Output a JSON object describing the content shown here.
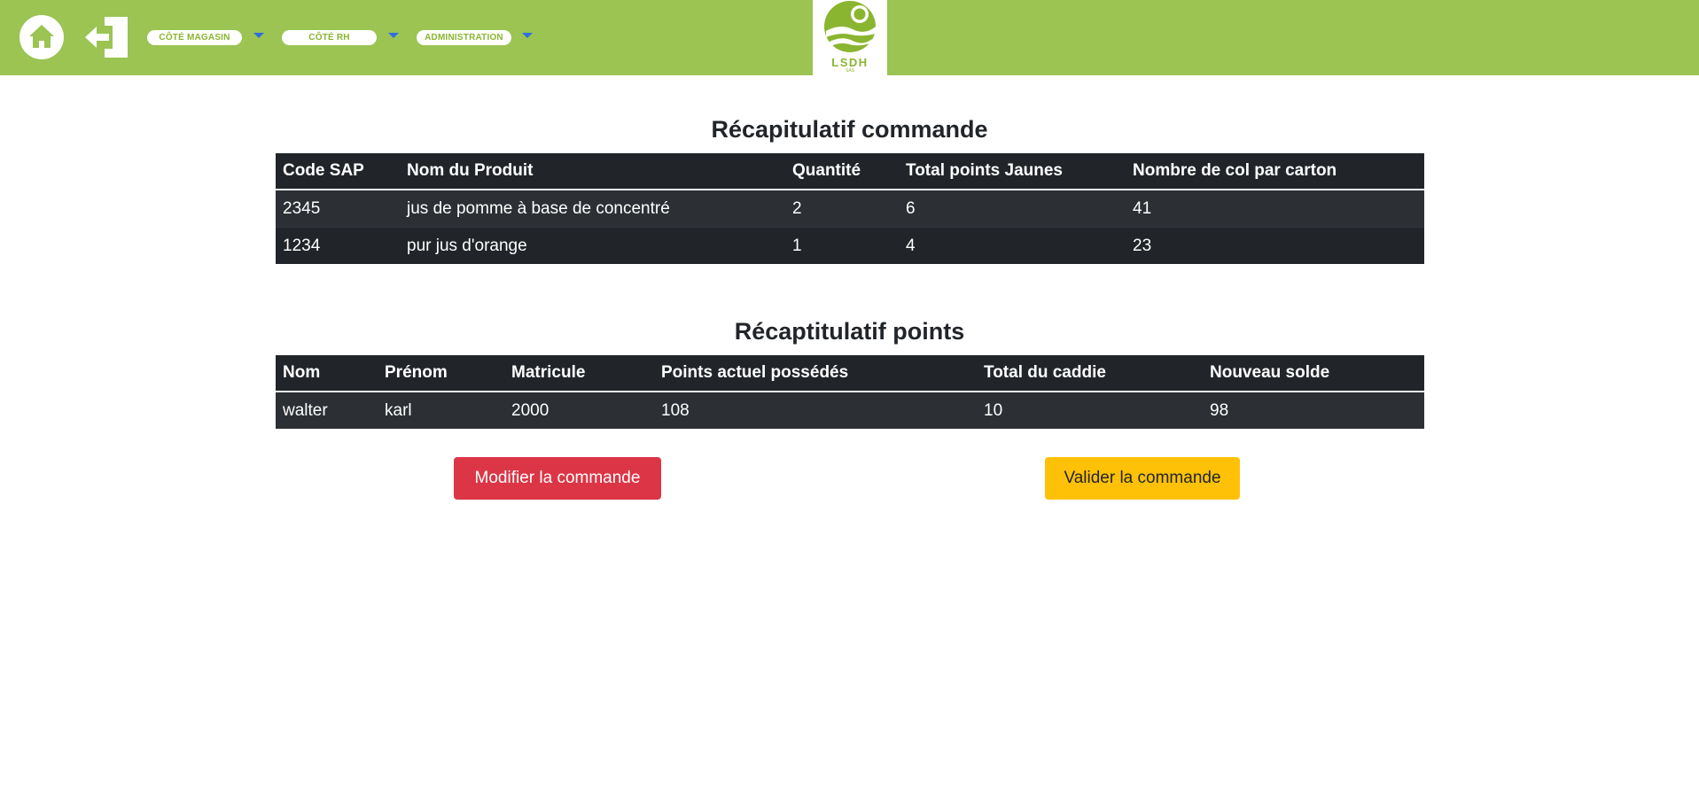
{
  "nav": {
    "icons": {
      "home": "home-icon",
      "logout": "logout-icon",
      "dropdown": "caret-down-icon"
    },
    "menus": [
      {
        "label": "CÔTÉ MAGASIN"
      },
      {
        "label": "CÔTÉ RH"
      },
      {
        "label": "ADMINISTRATION"
      }
    ],
    "logo": {
      "name": "LSDH",
      "sub": "SAS"
    }
  },
  "colors": {
    "brand_green": "#9bc453",
    "logo_green": "#8ab530",
    "table_dark": "#212529",
    "danger": "#dc3545",
    "warning": "#ffc107",
    "dropdown_caret": "#2f6fe0"
  },
  "order_summary": {
    "title": "Récapitulatif commande",
    "headers": [
      "Code SAP",
      "Nom du Produit",
      "Quantité",
      "Total points Jaunes",
      "Nombre de col par carton"
    ],
    "rows": [
      [
        "2345",
        "jus de pomme à base de concentré",
        "2",
        "6",
        "41"
      ],
      [
        "1234",
        "pur jus d'orange",
        "1",
        "4",
        "23"
      ]
    ]
  },
  "points_summary": {
    "title": "Récaptitulatif points",
    "headers": [
      "Nom",
      "Prénom",
      "Matricule",
      "Points actuel possédés",
      "Total du caddie",
      "Nouveau solde"
    ],
    "rows": [
      [
        "walter",
        "karl",
        "2000",
        "108",
        "10",
        "98"
      ]
    ]
  },
  "actions": {
    "modify_label": "Modifier la commande",
    "validate_label": "Valider la commande"
  }
}
